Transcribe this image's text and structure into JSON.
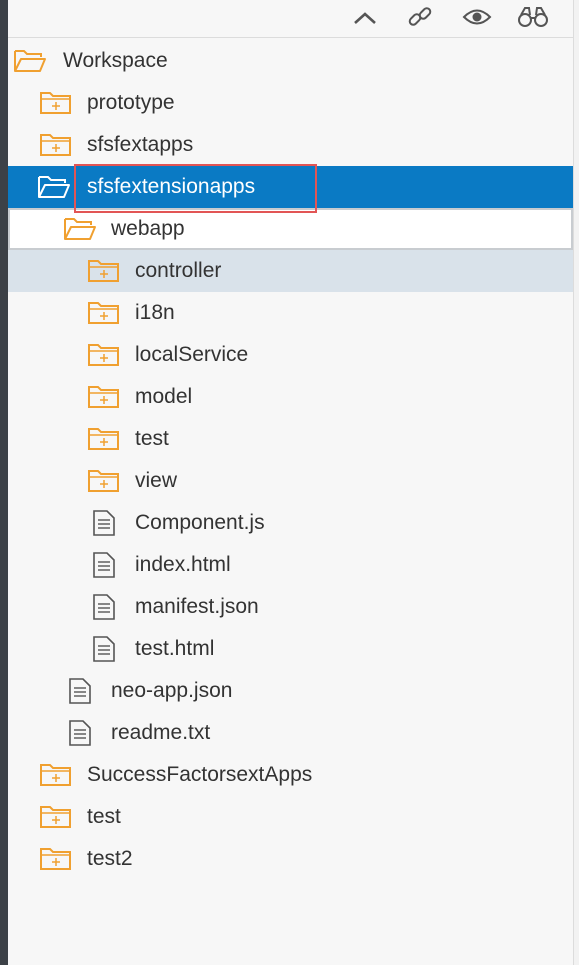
{
  "toolbar": {
    "icons": [
      "collapse-icon",
      "link-icon",
      "eye-icon",
      "binoculars-icon"
    ]
  },
  "tree": {
    "root": {
      "label": "Workspace",
      "icon": "folder-open-icon"
    },
    "items": [
      {
        "label": "prototype",
        "icon": "folder-closed-icon"
      },
      {
        "label": "sfsfextapps",
        "icon": "folder-closed-icon"
      },
      {
        "label": "sfsfextensionapps",
        "icon": "folder-open-icon",
        "selected": true
      },
      {
        "label": "webapp",
        "icon": "folder-open-icon"
      },
      {
        "label": "controller",
        "icon": "folder-closed-icon"
      },
      {
        "label": "i18n",
        "icon": "folder-closed-icon"
      },
      {
        "label": "localService",
        "icon": "folder-closed-icon"
      },
      {
        "label": "model",
        "icon": "folder-closed-icon"
      },
      {
        "label": "test",
        "icon": "folder-closed-icon"
      },
      {
        "label": "view",
        "icon": "folder-closed-icon"
      },
      {
        "label": "Component.js",
        "icon": "file-icon"
      },
      {
        "label": "index.html",
        "icon": "file-icon"
      },
      {
        "label": "manifest.json",
        "icon": "file-icon"
      },
      {
        "label": "test.html",
        "icon": "file-icon"
      },
      {
        "label": "neo-app.json",
        "icon": "file-icon"
      },
      {
        "label": "readme.txt",
        "icon": "file-icon"
      },
      {
        "label": "SuccessFactorsextApps",
        "icon": "folder-closed-icon"
      },
      {
        "label": "test",
        "icon": "folder-closed-icon"
      },
      {
        "label": "test2",
        "icon": "folder-closed-icon"
      }
    ]
  },
  "colors": {
    "folder": "#f0a030",
    "selected": "#0a7ac4",
    "highlight": "#e25555",
    "hover": "#d9e2ea"
  }
}
